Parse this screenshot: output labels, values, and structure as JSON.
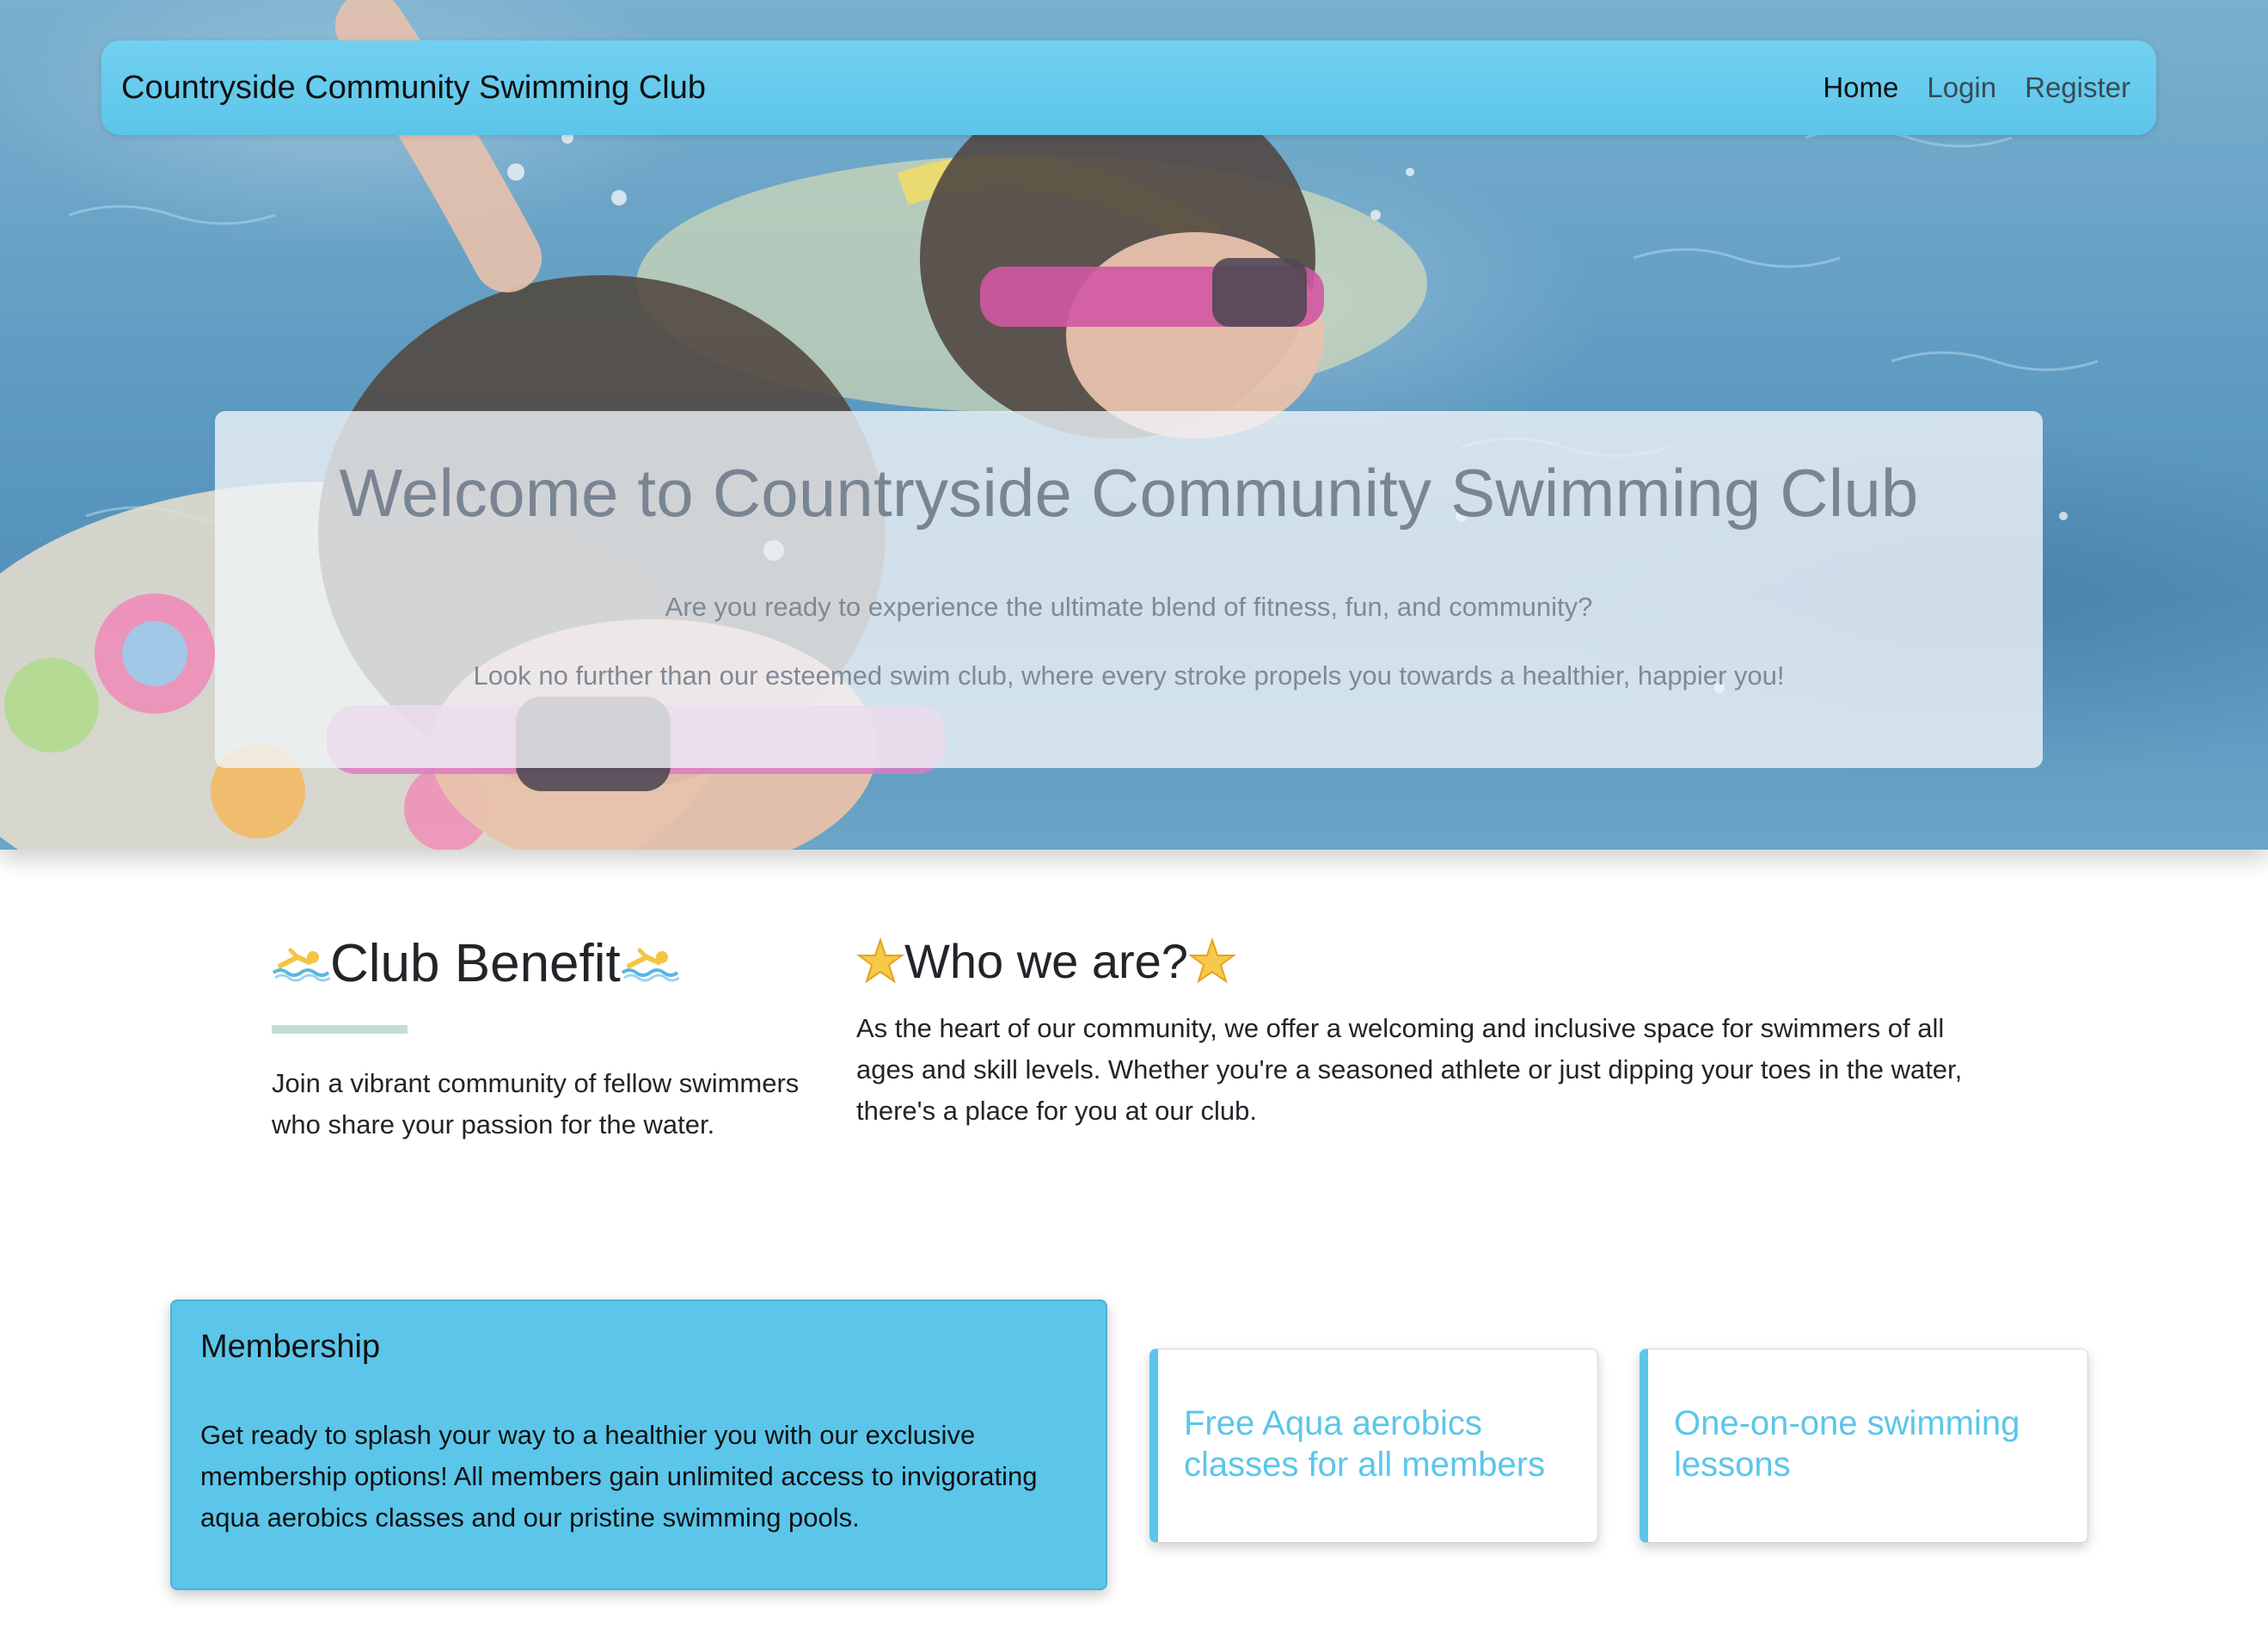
{
  "navbar": {
    "brand": "Countryside Community Swimming Club",
    "links": [
      {
        "label": "Home",
        "active": true
      },
      {
        "label": "Login",
        "active": false
      },
      {
        "label": "Register",
        "active": false
      }
    ]
  },
  "hero": {
    "title": "Welcome to Countryside Community Swimming Club",
    "subtitle_1": "Are you ready to experience the ultimate blend of fitness, fun, and community?",
    "subtitle_2": "Look no further than our esteemed swim club, where every stroke propels you towards a healthier, happier you!"
  },
  "benefit": {
    "title": "Club Benefit",
    "icon": "swimmer-icon",
    "text": "Join a vibrant community of fellow swimmers who share your passion for the water."
  },
  "who": {
    "title": "Who we are?",
    "icon": "star-icon",
    "text": "As the heart of our community, we offer a welcoming and inclusive space for swimmers of all ages and skill levels. Whether you're a seasoned athlete or just dipping your toes in the water, there's a place for you at our club."
  },
  "membership": {
    "title": "Membership",
    "text": "Get ready to splash your way to a healthier you with our exclusive membership options! All members gain unlimited access to invigorating aqua aerobics classes and our pristine swimming pools."
  },
  "features": [
    {
      "text": "Free Aqua aerobics classes for all members"
    },
    {
      "text": "One-on-one swimming lessons"
    }
  ],
  "colors": {
    "accent": "#5bc6ea",
    "rule": "#c3ddd4",
    "hero_text": "#7a8593"
  }
}
